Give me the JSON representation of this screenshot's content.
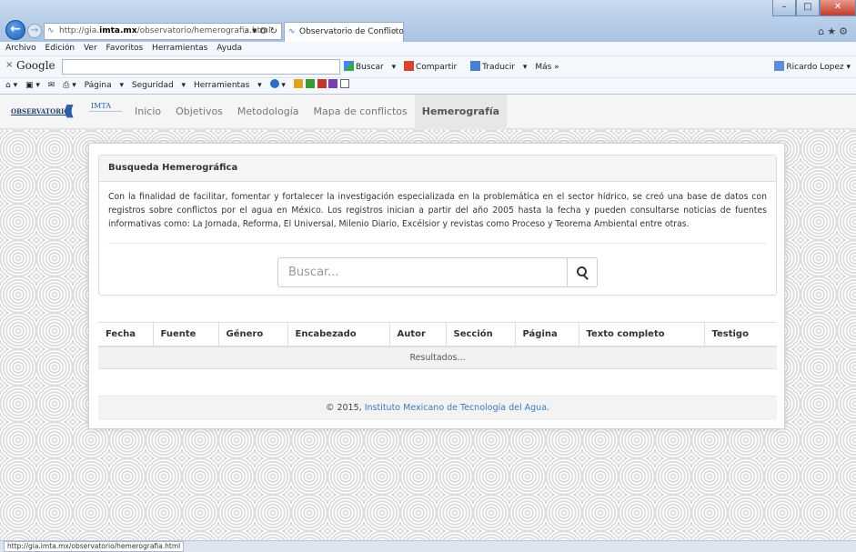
{
  "browser": {
    "address": {
      "prefix": "http://gia.",
      "domain": "imta.mx",
      "suffix": "/observatorio/hemerografia.html",
      "icons": "⌕ ▾ ⭗ ↻"
    },
    "tab_title": "Observatorio de Conflictos ...",
    "menu": [
      "Archivo",
      "Edición",
      "Ver",
      "Favoritos",
      "Herramientas",
      "Ayuda"
    ],
    "google": {
      "logo": "Google",
      "buscar": "Buscar",
      "compartir": "Compartir",
      "traducir": "Traducir",
      "mas": "Más »",
      "user": "Ricardo Lopez"
    },
    "command": {
      "pagina": "Página",
      "seguridad": "Seguridad",
      "herramientas": "Herramientas"
    },
    "status_url": "http://gia.imta.mx/observatorio/hemerografia.html"
  },
  "site": {
    "brand_text": "OBSERVATORIO",
    "brand_imta": "IMTA",
    "nav": [
      "Inicio",
      "Objetivos",
      "Metodología",
      "Mapa de conflictos",
      "Hemerografía"
    ],
    "active_nav": "Hemerografía",
    "panel_title": "Busqueda Hemerográfica",
    "panel_text": "Con la finalidad de facilitar, fomentar y fortalecer la investigación especializada en la problemática en el sector hídrico, se creó una base de datos con registros sobre conflictos por el agua en México. Los registros inician a partir del año 2005 hasta la fecha y pueden consultarse noticias de fuentes informativas como: La Jornada, Reforma, El Universal, Milenio Diario, Excélsior y revistas como Proceso y Teorema Ambiental entre otras.",
    "search_placeholder": "Buscar...",
    "table_headers": [
      "Fecha",
      "Fuente",
      "Género",
      "Encabezado",
      "Autor",
      "Sección",
      "Página",
      "Texto completo",
      "Testigo"
    ],
    "results_text": "Resultados...",
    "footer_prefix": "© 2015, ",
    "footer_link": "Instituto Mexicano de Tecnología del Agua."
  }
}
